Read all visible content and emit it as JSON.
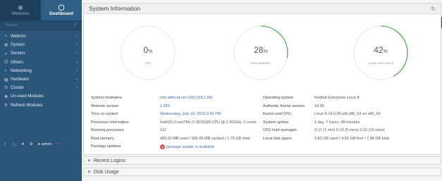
{
  "sidebar": {
    "tab_webmin": "Webmin",
    "tab_dashboard": "Dashboard",
    "search_placeholder": "Search",
    "items": [
      {
        "label": "Webmin",
        "icon": "gauge-icon"
      },
      {
        "label": "System",
        "icon": "wrench-icon"
      },
      {
        "label": "Servers",
        "icon": "rocket-icon"
      },
      {
        "label": "Others",
        "icon": "file-icon"
      },
      {
        "label": "Networking",
        "icon": "network-icon"
      },
      {
        "label": "Hardware",
        "icon": "server-icon"
      },
      {
        "label": "Cluster",
        "icon": "power-icon"
      },
      {
        "label": "Un-used Modules",
        "icon": "puzzle-icon"
      },
      {
        "label": "Refresh Modules",
        "icon": "refresh-icon"
      }
    ],
    "footer_user": "admin"
  },
  "panel": {
    "title": "System Information"
  },
  "gauges": [
    {
      "value": 0,
      "unit": "%",
      "label": "CPU"
    },
    {
      "value": 28,
      "unit": "%",
      "label": "REAL MEMORY"
    },
    {
      "value": 42,
      "unit": "%",
      "label": "LOCAL DISK SPACE"
    }
  ],
  "info_left": [
    {
      "key": "System hostname",
      "value": "rhel.attlocal.net (192.168.1.96)"
    },
    {
      "key": "Webmin version",
      "value": "1.920"
    },
    {
      "key": "Time on system",
      "value": "Wednesday, July 24, 2019 3:49 PM"
    },
    {
      "key": "Processor information",
      "value": "Intel(R) Core(TM) i7-3615QM CPU @ 2.30GHz, 1 cores"
    },
    {
      "key": "Running processes",
      "value": "112"
    },
    {
      "key": "Real memory",
      "value": "495.52 MB used / 956.65 MB cached / 1.79 GB total"
    },
    {
      "key": "Package updates",
      "value": "package update is available",
      "badge": "1"
    }
  ],
  "info_right": [
    {
      "key": "Operating system",
      "value": "Redhat Enterprise Linux 8"
    },
    {
      "key": "Authentic theme version",
      "value": "19.36"
    },
    {
      "key": "Kernel and CPU",
      "value": "Linux 4.18.0-80.el8.x86_64 on x86_64"
    },
    {
      "key": "System uptime",
      "value": "1 day, 7 hours, 48 minutes"
    },
    {
      "key": "CPU load averages",
      "value": "0.17 (1 min) 0.19 (5 mins) 0.10 (15 mins)"
    },
    {
      "key": "Local disk space",
      "value": "3.43 GB used / 4.56 GB free / 7.98 GB total"
    }
  ],
  "sections": [
    {
      "label": "Recent Logins"
    },
    {
      "label": "Disk Usage"
    }
  ],
  "colors": {
    "gauge_arc": "#4cae4c",
    "gauge_track": "#e6e6e6",
    "badge": "#d9534f",
    "sidebar": "#2b5579"
  }
}
